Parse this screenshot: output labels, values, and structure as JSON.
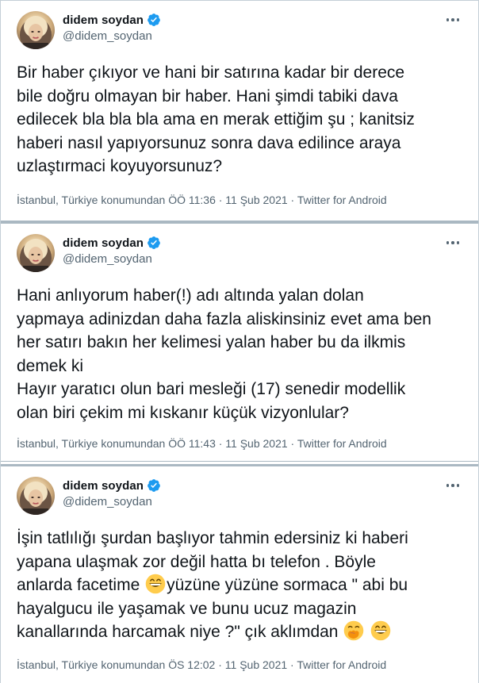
{
  "tweets": [
    {
      "author": {
        "name": "didem soydan",
        "handle": "@didem_soydan"
      },
      "lines": [
        "Bir haber çıkıyor ve hani bir satırına kadar bir derece",
        "bile doğru olmayan bir haber. Hani şimdi tabiki dava",
        "edilecek bla bla bla  ama en merak ettiğim şu ; kanitsiz",
        "haberi nasıl yapıyorsunuz sonra dava edilince araya",
        "uzlaştırmaci koyuyorsunuz?"
      ],
      "meta_text": "İstanbul, Türkiye konumundan ÖÖ 11:36 · 11 Şub 2021 · ",
      "source": "Twitter for Android"
    },
    {
      "author": {
        "name": "didem soydan",
        "handle": "@didem_soydan"
      },
      "lines": [
        "Hani anlıyorum haber(!) adı altında yalan dolan",
        "yapmaya adinizdan daha fazla aliskinsiniz evet ama ben",
        "her satırı bakın her kelimesi yalan haber bu da ilkmis",
        "demek ki",
        "Hayır yaratıcı olun bari mesleği (17) senedir modellik",
        "olan biri çekim mi kıskanır küçük vizyonlular?"
      ],
      "meta_text": "İstanbul, Türkiye konumundan ÖÖ 11:43 · 11 Şub 2021 · ",
      "source": "Twitter for Android"
    },
    {
      "author": {
        "name": "didem soydan",
        "handle": "@didem_soydan"
      },
      "lines": [
        "İşin tatlılığı şurdan başlıyor tahmin edersiniz ki haberi",
        "yapana ulaşmak zor değil hatta bı telefon . Böyle",
        "anlarda facetime",
        "yüzüne yüzüne sormaca \" abi bu",
        "hayalgucu ile yaşamak ve bunu ucuz magazin",
        "kanallarında harcamak niye ?\" çık aklımdan"
      ],
      "meta_text": "İstanbul, Türkiye konumundan ÖS 12:02 · 11 Şub 2021 · ",
      "source": "Twitter for Android"
    }
  ],
  "icons": {
    "verified": "verified-badge-icon",
    "more": "more-options-icon",
    "grin": "grinning-face-emoji",
    "hand_over_mouth": "face-with-hand-over-mouth-emoji"
  },
  "colors": {
    "text": "#0f1419",
    "secondary": "#536471",
    "verified_blue": "#1d9bf0",
    "divider": "#aab8c2"
  }
}
